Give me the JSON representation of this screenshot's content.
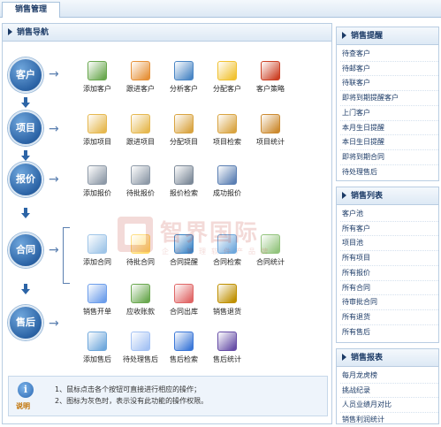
{
  "tab": {
    "label": "销售管理"
  },
  "nav": {
    "title": "销售导航",
    "stages": [
      "客户",
      "项目",
      "报价",
      "合同",
      "售后"
    ],
    "rows": [
      {
        "items": [
          {
            "label": "添加客户",
            "icon": "person-add-icon",
            "color": "#6aa84f"
          },
          {
            "label": "跟进客户",
            "icon": "person-edit-icon",
            "color": "#e69138"
          },
          {
            "label": "分析客户",
            "icon": "chart-doc-icon",
            "color": "#4a86c5"
          },
          {
            "label": "分配客户",
            "icon": "magnifier-doc-icon",
            "color": "#f1c232"
          },
          {
            "label": "客户策略",
            "icon": "pie-doc-icon",
            "color": "#cc4125"
          }
        ]
      },
      {
        "items": [
          {
            "label": "添加项目",
            "icon": "folder-add-icon",
            "color": "#e6b84f"
          },
          {
            "label": "跟进项目",
            "icon": "folder-edit-icon",
            "color": "#e6b84f"
          },
          {
            "label": "分配项目",
            "icon": "folder-assign-icon",
            "color": "#d9a441"
          },
          {
            "label": "项目检索",
            "icon": "folder-search-icon",
            "color": "#d9a441"
          },
          {
            "label": "项目统计",
            "icon": "folder-chart-icon",
            "color": "#cc8a2f"
          }
        ]
      },
      {
        "items": [
          {
            "label": "添加报价",
            "icon": "database-add-icon",
            "color": "#8e9aa8"
          },
          {
            "label": "待批报价",
            "icon": "database-warn-icon",
            "color": "#8e9aa8"
          },
          {
            "label": "报价检索",
            "icon": "database-search-icon",
            "color": "#7d8a99"
          },
          {
            "label": "成功报价",
            "icon": "magnifier-icon",
            "color": "#5b7fb3"
          }
        ]
      },
      {
        "items": [
          {
            "label": "添加合同",
            "icon": "document-add-icon",
            "color": "#9fc5e8"
          },
          {
            "label": "待批合同",
            "icon": "document-warn-icon",
            "color": "#ffd966"
          },
          {
            "label": "合同提醒",
            "icon": "speaker-icon",
            "color": "#3d85c6"
          },
          {
            "label": "合同检索",
            "icon": "document-search-icon",
            "color": "#6fa8dc"
          },
          {
            "label": "合同统计",
            "icon": "document-chart-icon",
            "color": "#93c47d"
          }
        ]
      },
      {
        "items": [
          {
            "label": "销售开单",
            "icon": "order-icon",
            "color": "#6d9eeb"
          },
          {
            "label": "应收账款",
            "icon": "ledger-check-icon",
            "color": "#6aa84f"
          },
          {
            "label": "合同出库",
            "icon": "box-out-icon",
            "color": "#e06666"
          },
          {
            "label": "销售退货",
            "icon": "money-return-icon",
            "color": "#bf9000"
          }
        ]
      },
      {
        "items": [
          {
            "label": "添加售后",
            "icon": "service-add-icon",
            "color": "#6fa8dc"
          },
          {
            "label": "待处理售后",
            "icon": "service-pending-icon",
            "color": "#a4c2f4"
          },
          {
            "label": "售后检索",
            "icon": "service-search-icon",
            "color": "#3c78d8"
          },
          {
            "label": "售后统计",
            "icon": "line-chart-icon",
            "color": "#674ea7"
          }
        ]
      }
    ],
    "note": {
      "label": "说明",
      "lines": [
        "1、鼠标点击各个按钮可直接进行相应的操作；",
        "2、图标为灰色时，表示没有此功能的操作权限。"
      ]
    }
  },
  "sidebar": {
    "reminder": {
      "title": "销售提醒",
      "items": [
        "待查客户",
        "待邮客户",
        "待联客户",
        "即将到期提醒客户",
        "上门客户",
        "本月生日提醒",
        "本日生日提醒",
        "即将到期合同",
        "待处理售后"
      ]
    },
    "lists": {
      "title": "销售列表",
      "items": [
        "客户池",
        "所有客户",
        "项目池",
        "所有项目",
        "所有报价",
        "所有合同",
        "待审批合同",
        "所有退货",
        "所有售后"
      ]
    },
    "reports": {
      "title": "销售报表",
      "items": [
        "每月龙虎榜",
        "挑战纪录",
        "人员业绩月对比",
        "销售利润统计"
      ]
    }
  },
  "watermark": {
    "text": "智界国际",
    "sub": "企业管理软件产品牌"
  },
  "colors": {
    "accent": "#2c64a6",
    "header_text": "#1b3a66",
    "border": "#b9cde2"
  }
}
